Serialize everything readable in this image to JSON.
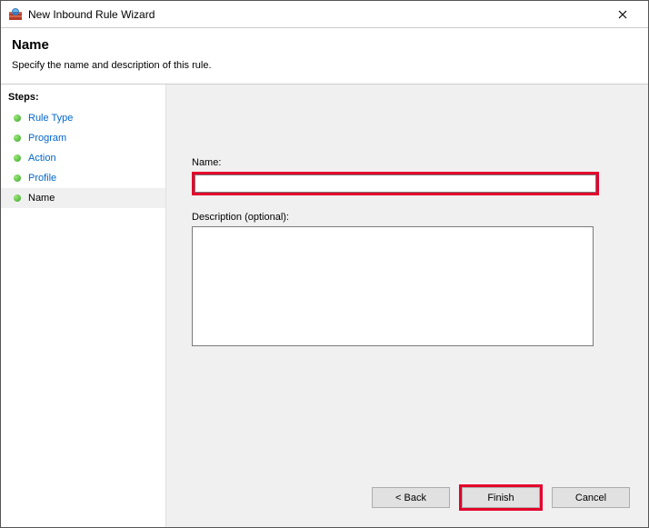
{
  "window": {
    "title": "New Inbound Rule Wizard"
  },
  "header": {
    "heading": "Name",
    "subtext": "Specify the name and description of this rule."
  },
  "steps": {
    "label": "Steps:",
    "items": [
      {
        "label": "Rule Type",
        "current": false
      },
      {
        "label": "Program",
        "current": false
      },
      {
        "label": "Action",
        "current": false
      },
      {
        "label": "Profile",
        "current": false
      },
      {
        "label": "Name",
        "current": true
      }
    ]
  },
  "form": {
    "name_label": "Name:",
    "name_value": "",
    "desc_label": "Description (optional):",
    "desc_value": ""
  },
  "buttons": {
    "back": "< Back",
    "finish": "Finish",
    "cancel": "Cancel"
  }
}
